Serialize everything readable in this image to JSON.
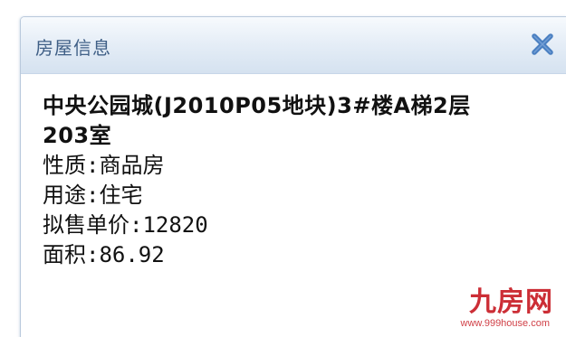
{
  "dialog": {
    "title": "房屋信息",
    "close_icon": "close-icon"
  },
  "property": {
    "name_line1": "中央公园城(J2010P05地块)3#楼A梯2层",
    "name_line2": "203室",
    "nature": "性质:商品房",
    "usage": "用途:住宅",
    "unit_price": "拟售单价:12820",
    "area": "面积:86.92"
  },
  "watermark": {
    "logo": "九房网",
    "url": "www.999house.com"
  },
  "colors": {
    "title_text": "#3f5f86",
    "titlebar_top": "#f7fafd",
    "titlebar_bottom": "#d5e2f0",
    "close_icon": "#4a7fc1",
    "watermark": "#c81d25"
  }
}
